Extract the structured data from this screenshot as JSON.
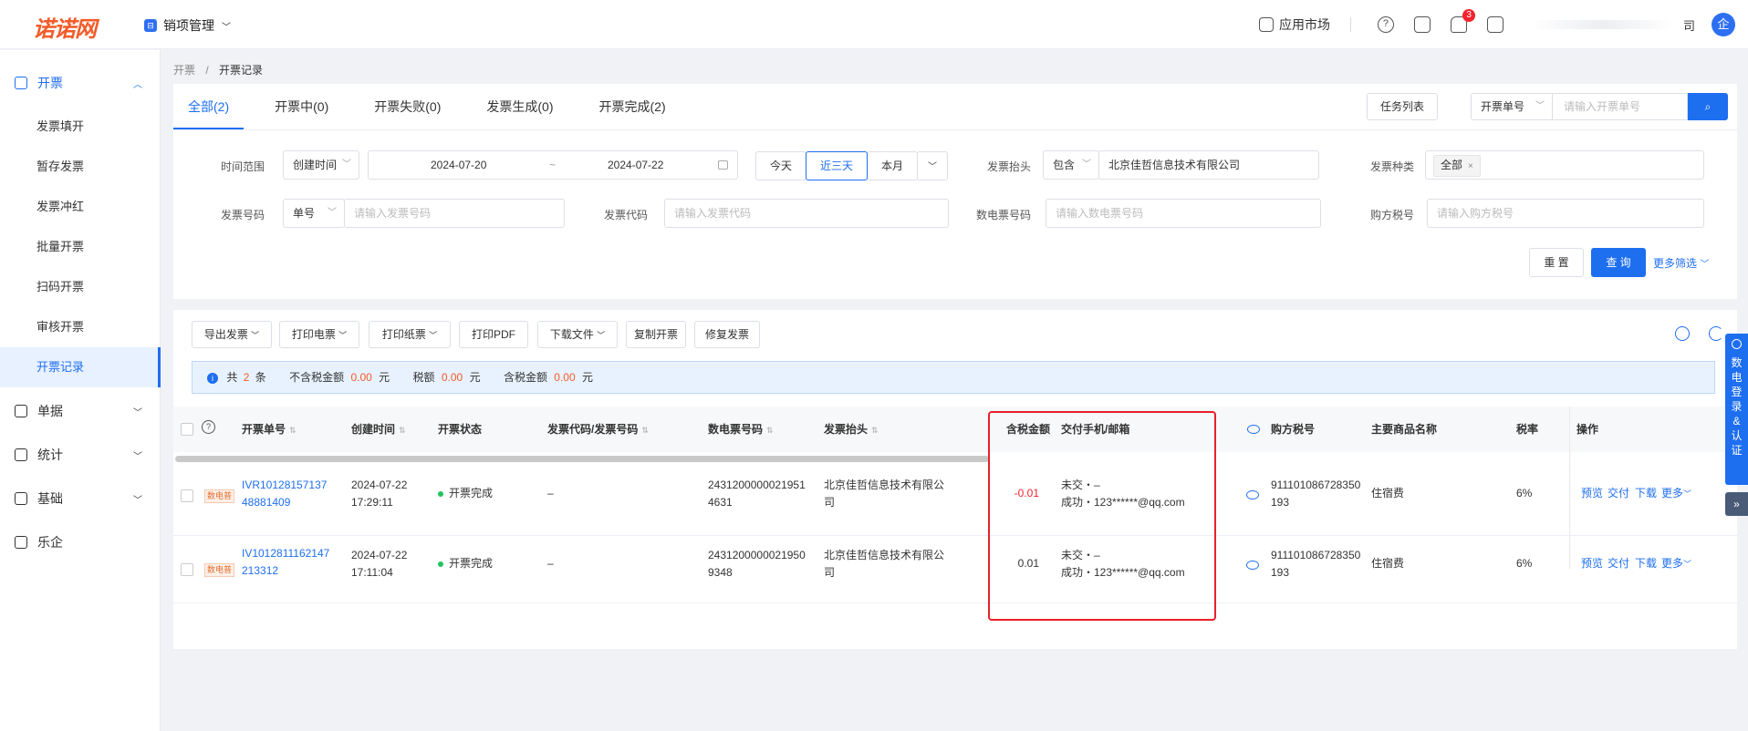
{
  "header": {
    "logo": "诺诺网",
    "app_icon_glyph": "⊟",
    "app_name": "销项管理",
    "market": "应用市场",
    "help_glyph": "?",
    "notif_count": "3",
    "company_tail": "司",
    "avatar": "企"
  },
  "sidebar": {
    "group_invoice": "开票",
    "items": [
      "发票填开",
      "暂存发票",
      "发票冲红",
      "批量开票",
      "扫码开票",
      "审核开票",
      "开票记录"
    ],
    "group_docs": "单据",
    "group_stats": "统计",
    "group_base": "基础",
    "group_leqi": "乐企"
  },
  "breadcrumb": {
    "parent": "开票",
    "sep": "/",
    "current": "开票记录"
  },
  "tabs": [
    "全部(2)",
    "开票中(0)",
    "开票失败(0)",
    "发票生成(0)",
    "开票完成(2)"
  ],
  "top_actions": {
    "task_list": "任务列表",
    "search_type": "开票单号",
    "search_placeholder": "请输入开票单号"
  },
  "filters": {
    "time_range_label": "时间范围",
    "time_type": "创建时间",
    "date_start": "2024-07-20",
    "date_sep": "~",
    "date_end": "2024-07-22",
    "quick": [
      "今天",
      "近三天",
      "本月"
    ],
    "title_label": "发票抬头",
    "title_op": "包含",
    "title_value": "北京佳哲信息技术有限公司",
    "kind_label": "发票种类",
    "kind_tag": "全部",
    "invoice_no_label": "发票号码",
    "invoice_no_type": "单号",
    "invoice_no_placeholder": "请输入发票号码",
    "invoice_code_label": "发票代码",
    "invoice_code_placeholder": "请输入发票代码",
    "digital_no_label": "数电票号码",
    "digital_no_placeholder": "请输入数电票号码",
    "buyer_tax_label": "购方税号",
    "buyer_tax_placeholder": "请输入购方税号",
    "reset": "重 置",
    "query": "查 询",
    "more_filter": "更多筛选"
  },
  "toolbar": [
    "导出发票",
    "打印电票",
    "打印纸票",
    "打印PDF",
    "下载文件",
    "复制开票",
    "修复发票"
  ],
  "summary": {
    "total_prefix": "共",
    "total": "2",
    "total_unit": "条",
    "untaxed_label": "不含税金额",
    "untaxed": "0.00",
    "yuan": "元",
    "tax_label": "税额",
    "tax": "0.00",
    "taxed_label": "含税金额",
    "taxed": "0.00"
  },
  "columns": [
    "开票单号",
    "创建时间",
    "开票状态",
    "发票代码/发票号码",
    "数电票号码",
    "发票抬头",
    "含税金额",
    "交付手机/邮箱",
    "购方税号",
    "主要商品名称",
    "税率",
    "操作"
  ],
  "rows": [
    {
      "tag": "数电普",
      "order_no_1": "IVR10128157137",
      "order_no_2": "48881409",
      "date": "2024-07-22",
      "time": "17:29:11",
      "status": "开票完成",
      "code": "–",
      "digital_1": "2431200000021951",
      "digital_2": "4631",
      "title_1": "北京佳哲信息技术有限公",
      "title_2": "司",
      "amount": "-0.01",
      "deliver_1": "未交・–",
      "deliver_2": "成功・123******@qq.com",
      "buyer_tax_1": "911101086728350",
      "buyer_tax_2": "193",
      "goods": "住宿费",
      "rate": "6%"
    },
    {
      "tag": "数电普",
      "order_no_1": "IV1012811162147",
      "order_no_2": "213312",
      "date": "2024-07-22",
      "time": "17:11:04",
      "status": "开票完成",
      "code": "–",
      "digital_1": "2431200000021950",
      "digital_2": "9348",
      "title_1": "北京佳哲信息技术有限公",
      "title_2": "司",
      "amount": "0.01",
      "deliver_1": "未交・–",
      "deliver_2": "成功・123******@qq.com",
      "buyer_tax_1": "911101086728350",
      "buyer_tax_2": "193",
      "goods": "住宿费",
      "rate": "6%"
    }
  ],
  "row_actions": {
    "preview": "预览",
    "deliver": "交付",
    "download": "下载",
    "more": "更多"
  },
  "float_panel": "数电登录&认证",
  "colors": {
    "primary": "#1e6ef0",
    "danger": "#e8202a",
    "success": "#22c35e",
    "orange": "#f25c2a"
  }
}
